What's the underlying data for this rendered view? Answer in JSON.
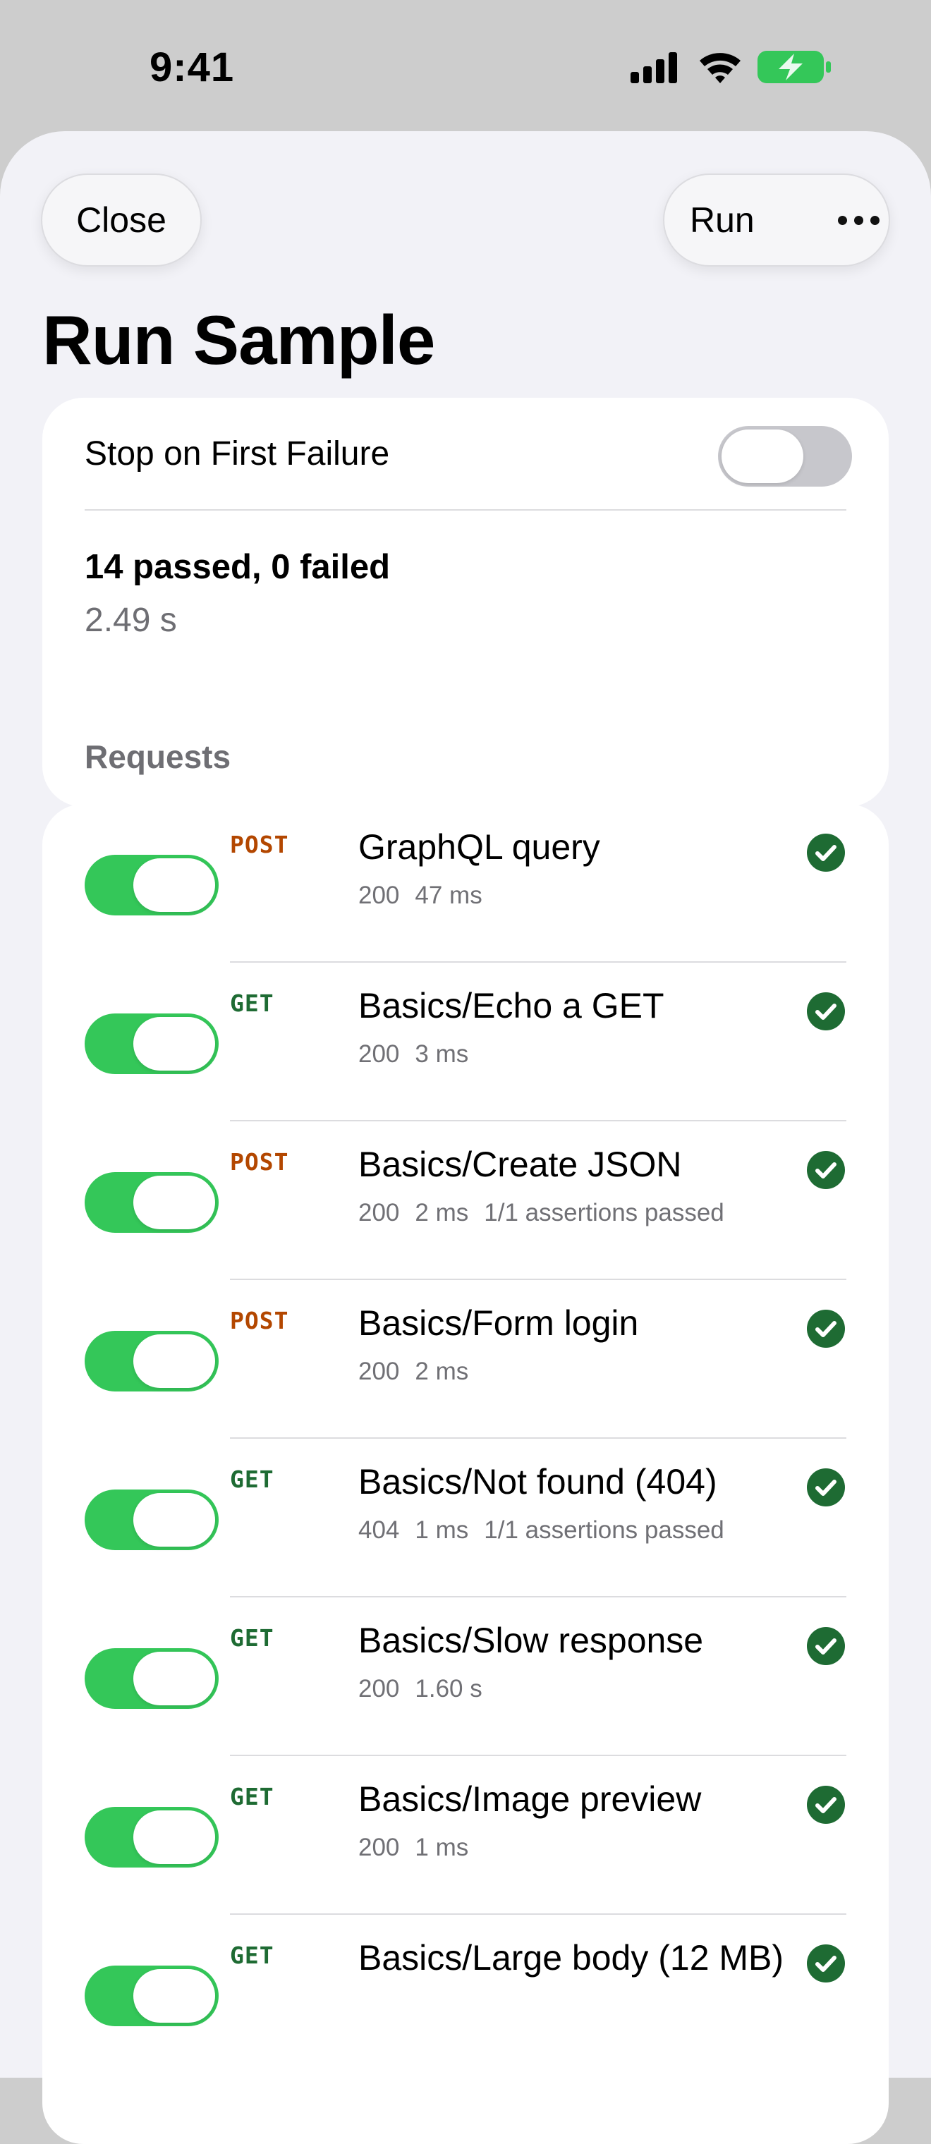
{
  "status_bar": {
    "time": "9:41"
  },
  "header": {
    "close_label": "Close",
    "run_label": "Run",
    "title": "Run Sample"
  },
  "summary": {
    "stop_label": "Stop on First Failure",
    "stop_enabled": false,
    "results": "14 passed, 0 failed",
    "duration": "2.49 s"
  },
  "requests_header": "Requests",
  "requests": [
    {
      "method": "POST",
      "name": "GraphQL query",
      "status": "200",
      "time": "47 ms",
      "assertions": "",
      "enabled": true,
      "passed": true
    },
    {
      "method": "GET",
      "name": "Basics/Echo a GET",
      "status": "200",
      "time": "3 ms",
      "assertions": "",
      "enabled": true,
      "passed": true
    },
    {
      "method": "POST",
      "name": "Basics/Create JSON",
      "status": "200",
      "time": "2 ms",
      "assertions": "1/1 assertions passed",
      "enabled": true,
      "passed": true
    },
    {
      "method": "POST",
      "name": "Basics/Form login",
      "status": "200",
      "time": "2 ms",
      "assertions": "",
      "enabled": true,
      "passed": true
    },
    {
      "method": "GET",
      "name": "Basics/Not found (404)",
      "status": "404",
      "time": "1 ms",
      "assertions": "1/1 assertions passed",
      "enabled": true,
      "passed": true
    },
    {
      "method": "GET",
      "name": "Basics/Slow response",
      "status": "200",
      "time": "1.60 s",
      "assertions": "",
      "enabled": true,
      "passed": true
    },
    {
      "method": "GET",
      "name": "Basics/Image preview",
      "status": "200",
      "time": "1 ms",
      "assertions": "",
      "enabled": true,
      "passed": true
    },
    {
      "method": "GET",
      "name": "Basics/Large body (12 MB)",
      "status": "",
      "time": "",
      "assertions": "",
      "enabled": true,
      "passed": true
    }
  ],
  "colors": {
    "toggle_on": "#34c759",
    "toggle_off": "#c7c7cc",
    "post": "#b34700",
    "get": "#1e6b33",
    "check": "#1e6b33"
  }
}
